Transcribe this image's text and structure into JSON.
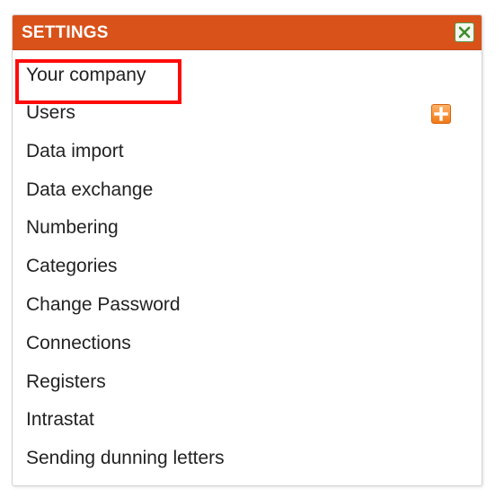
{
  "settings": {
    "title": "SETTINGS",
    "close_icon": "close-icon",
    "header_color": "#d9521a",
    "highlight_color": "#ff0a0a",
    "items": [
      {
        "label": "Your company",
        "highlighted": true
      },
      {
        "label": "Users",
        "action_icon": "plus-icon"
      },
      {
        "label": "Data import"
      },
      {
        "label": "Data exchange"
      },
      {
        "label": "Numbering"
      },
      {
        "label": "Categories"
      },
      {
        "label": "Change Password"
      },
      {
        "label": "Connections"
      },
      {
        "label": "Registers"
      },
      {
        "label": "Intrastat"
      },
      {
        "label": "Sending dunning letters"
      }
    ]
  }
}
